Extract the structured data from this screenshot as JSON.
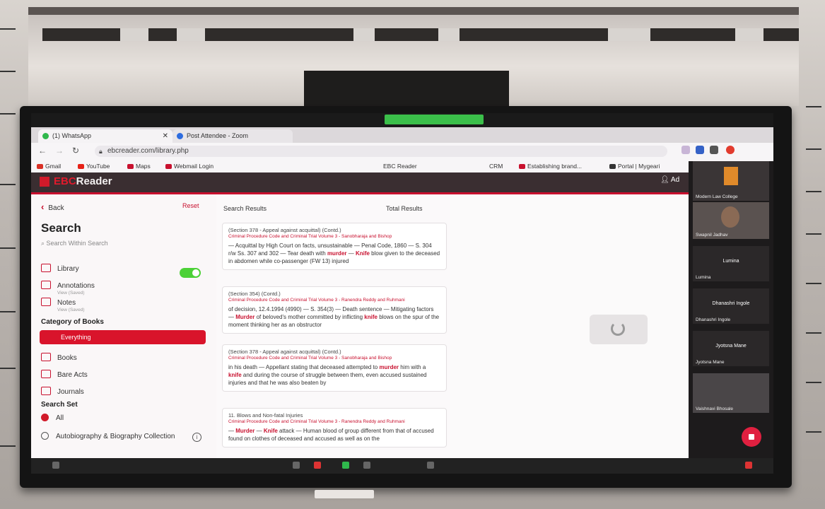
{
  "browser": {
    "tabs": [
      {
        "label": "(1) WhatsApp",
        "icon": "whatsapp-icon",
        "color": "#2fb84c"
      },
      {
        "label": "Post Attendee - Zoom",
        "icon": "zoom-icon",
        "color": "#2d6cdf"
      }
    ],
    "url": "ebcreader.com/library.php",
    "bookmarks": [
      {
        "label": "Gmail",
        "color": "#d93025"
      },
      {
        "label": "YouTube",
        "color": "#e62117"
      },
      {
        "label": "Maps",
        "color": "#c8102e"
      },
      {
        "label": "Webmail Login",
        "color": "#c8102e"
      },
      {
        "label": "EBC Reader",
        "color": "#c8102e"
      },
      {
        "label": "CRM",
        "color": "#888888"
      },
      {
        "label": "Establishing brand...",
        "color": "#c8102e"
      },
      {
        "label": "Portal | Mygeari",
        "color": "#333333"
      }
    ]
  },
  "app": {
    "logo_accent": "EBC",
    "logo_text": "Reader",
    "user": "Ad"
  },
  "sidebar": {
    "back": "Back",
    "reset": "Reset",
    "title": "Search",
    "search_placeholder": "Search Within Search",
    "items": [
      {
        "label": "Library",
        "sub": ""
      },
      {
        "label": "Annotations",
        "sub": "View (Saved)"
      },
      {
        "label": "Notes",
        "sub": "View (Saved)"
      }
    ],
    "category_title": "Category of Books",
    "category_selected": "Everything",
    "categories": [
      "Books",
      "Bare Acts",
      "Journals"
    ],
    "search_set_title": "Search Set",
    "search_set": [
      {
        "label": "All",
        "selected": true
      },
      {
        "label": "Autobiography & Biography Collection",
        "selected": false
      }
    ]
  },
  "results": {
    "header": "Search Results",
    "total": "Total Results",
    "cards": [
      {
        "heading": "(Section 378 - Appeal against acquittal) (Contd.)",
        "source": "Criminal Procedure Code and Criminal Trial Volume 3 - Sanobharaja and Bishop",
        "body_pre": "— Acquittal by High Court on facts, unsustainable — Penal Code, 1860 — S. 304 r/w Ss. 307 and 302 — Tear death with ",
        "hl1": "murder",
        "mid": " — ",
        "hl2": "Knife",
        "body_post": " blow given to the deceased in abdomen while co-passenger (FW 13) injured"
      },
      {
        "heading": "(Section 354) (Contd.)",
        "source": "Criminal Procedure Code and Criminal Trial Volume 3 - Ranendra Reddy and Ruhmani",
        "body_pre": "of decision, 12.4.1994 (4990) — S. 354(3) — Death sentence — Mitigating factors — ",
        "hl1": "Murder",
        "mid": " of beloved's mother committed by inflicting ",
        "hl2": "knife",
        "body_post": " blows on the spur of the moment thinking her as an obstructor"
      },
      {
        "heading": "(Section 378 - Appeal against acquittal) (Contd.)",
        "source": "Criminal Procedure Code and Criminal Trial Volume 3 - Sanobharaja and Bishop",
        "body_pre": "in his death — Appellant stating that deceased attempted to ",
        "hl1": "murder",
        "mid": " him with a ",
        "hl2": "knife",
        "body_post": " and during the course of struggle between them, even accused sustained injuries and that he was also beaten by"
      },
      {
        "heading": "11. Blows and Non-fatal Injuries",
        "source": "Criminal Procedure Code and Criminal Trial Volume 3 - Ranendra Reddy and Ruhmani",
        "body_pre": "— ",
        "hl1": "Murder",
        "mid": " — ",
        "hl2": "Knife",
        "body_post": " attack — Human blood of group different from that of accused found on clothes of deceased and accused as well as on the"
      }
    ]
  },
  "participants": [
    {
      "name": "Modern Law College",
      "kind": "logo"
    },
    {
      "name": "Swapnil Jadhav",
      "kind": "video"
    },
    {
      "name": "Lumina",
      "kind": "name",
      "center": "Lumina"
    },
    {
      "name": "Dhanashri Ingole",
      "kind": "name",
      "center": "Dhanashri Ingole"
    },
    {
      "name": "Jyotsna Mane",
      "kind": "name",
      "center": "Jyotsna Mane"
    },
    {
      "name": "Vaishnavi Bhosale",
      "kind": "video"
    }
  ],
  "colors": {
    "accent": "#c8102e",
    "toggle_on": "#4cd137",
    "header_bg": "#3a2e31"
  }
}
